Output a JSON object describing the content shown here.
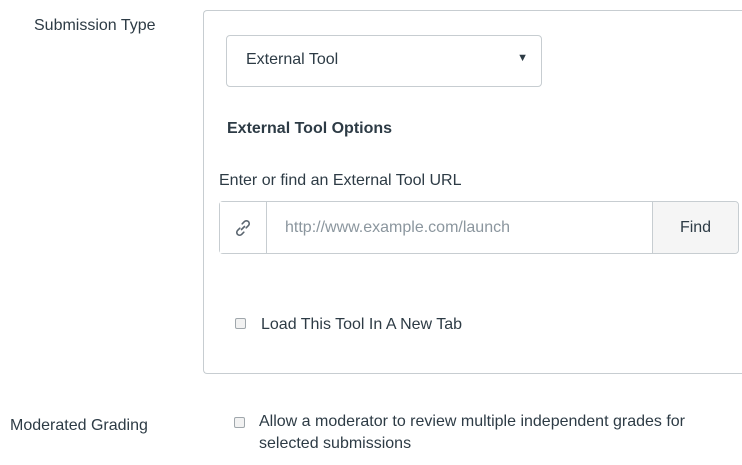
{
  "submission_type": {
    "label": "Submission Type",
    "selected": "External Tool",
    "arrow_icon": "caret-down"
  },
  "external_tool": {
    "section_title": "External Tool Options",
    "url_label": "Enter or find an External Tool URL",
    "url_value": "",
    "url_placeholder": "http://www.example.com/launch",
    "link_icon": "link-icon",
    "find_label": "Find",
    "new_tab_label": "Load This Tool In A New Tab",
    "new_tab_checked": false
  },
  "moderated_grading": {
    "label": "Moderated Grading",
    "checkbox_label": "Allow a moderator to review multiple independent grades for selected submissions",
    "checked": false
  }
}
